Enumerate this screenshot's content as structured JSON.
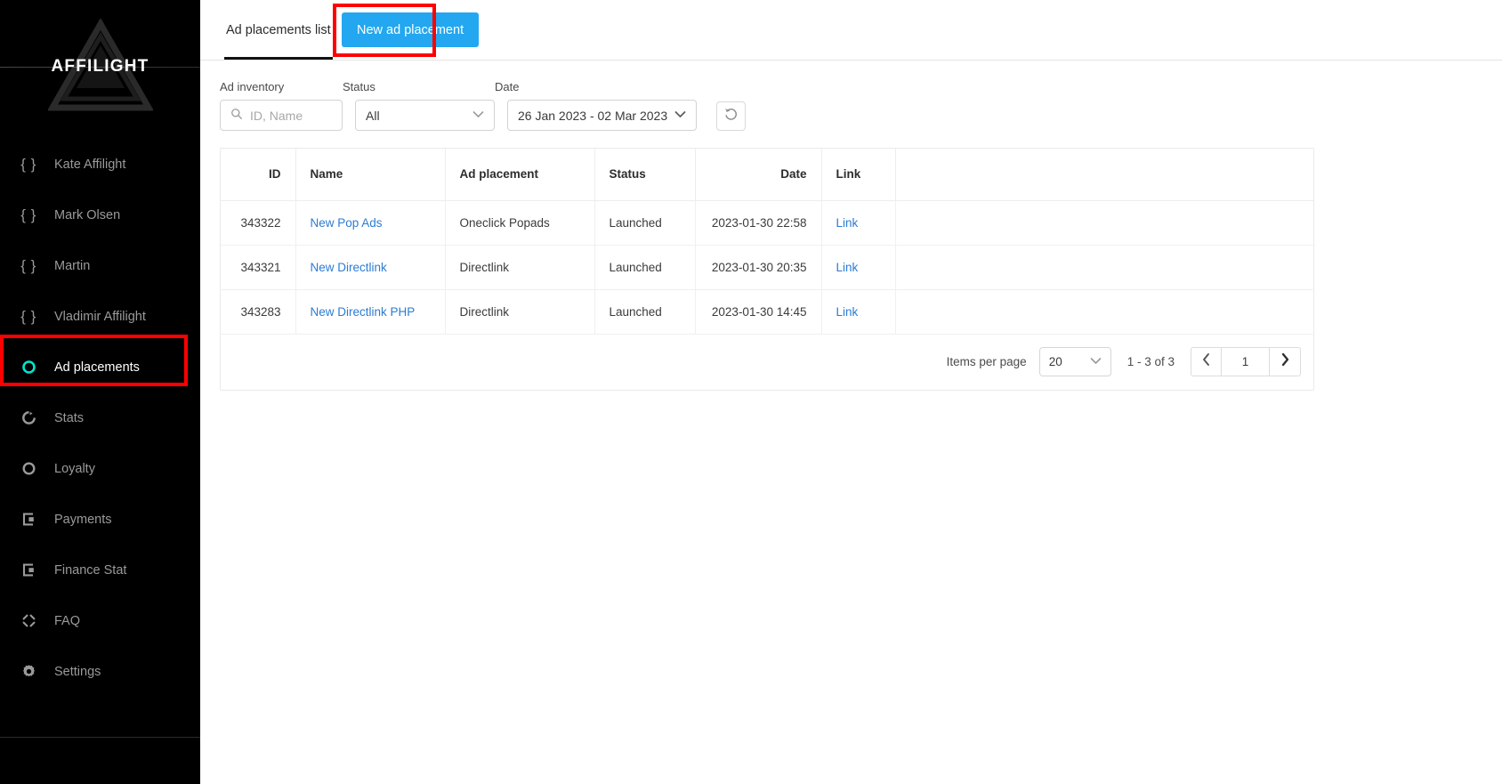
{
  "brand": {
    "name": "AFFILIGHT",
    "accent": "#00e5d0"
  },
  "sidebar": {
    "items": [
      {
        "label": "Kate Affilight",
        "icon": "braces-icon"
      },
      {
        "label": "Mark Olsen",
        "icon": "braces-icon"
      },
      {
        "label": "Martin",
        "icon": "braces-icon"
      },
      {
        "label": "Vladimir Affilight",
        "icon": "braces-icon"
      },
      {
        "label": "Ad placements",
        "icon": "circle-icon"
      },
      {
        "label": "Stats",
        "icon": "pie-chart-icon"
      },
      {
        "label": "Loyalty",
        "icon": "circle-icon"
      },
      {
        "label": "Payments",
        "icon": "card-icon"
      },
      {
        "label": "Finance Stat",
        "icon": "card-icon"
      },
      {
        "label": "FAQ",
        "icon": "diamond-brackets-icon"
      },
      {
        "label": "Settings",
        "icon": "gear-icon"
      }
    ]
  },
  "topbar": {
    "tab_label": "Ad placements list",
    "new_button_label": "New ad placement",
    "new_button_color": "#22a7f0"
  },
  "filters": {
    "inventory": {
      "label": "Ad inventory",
      "placeholder": "ID, Name",
      "value": ""
    },
    "status": {
      "label": "Status",
      "value": "All"
    },
    "date": {
      "label": "Date",
      "value": "26 Jan 2023 - 02 Mar 2023"
    },
    "refresh_icon": "reset-rotate-icon"
  },
  "table": {
    "columns": [
      "ID",
      "Name",
      "Ad placement",
      "Status",
      "Date",
      "Link",
      ""
    ],
    "rows": [
      {
        "id": "343322",
        "name": "New Pop Ads",
        "placement": "Oneclick Popads",
        "status": "Launched",
        "date": "2023-01-30 22:58",
        "link": "Link"
      },
      {
        "id": "343321",
        "name": "New Directlink",
        "placement": "Directlink",
        "status": "Launched",
        "date": "2023-01-30 20:35",
        "link": "Link"
      },
      {
        "id": "343283",
        "name": "New Directlink PHP",
        "placement": "Directlink",
        "status": "Launched",
        "date": "2023-01-30 14:45",
        "link": "Link"
      }
    ]
  },
  "pagination": {
    "items_per_page_label": "Items per page",
    "items_per_page_value": "20",
    "range": "1 - 3 of 3",
    "current_page": "1",
    "prev_icon": "chevron-left-icon",
    "next_icon": "chevron-right-icon"
  },
  "annotations": {
    "highlight_color": "#ff0000"
  }
}
